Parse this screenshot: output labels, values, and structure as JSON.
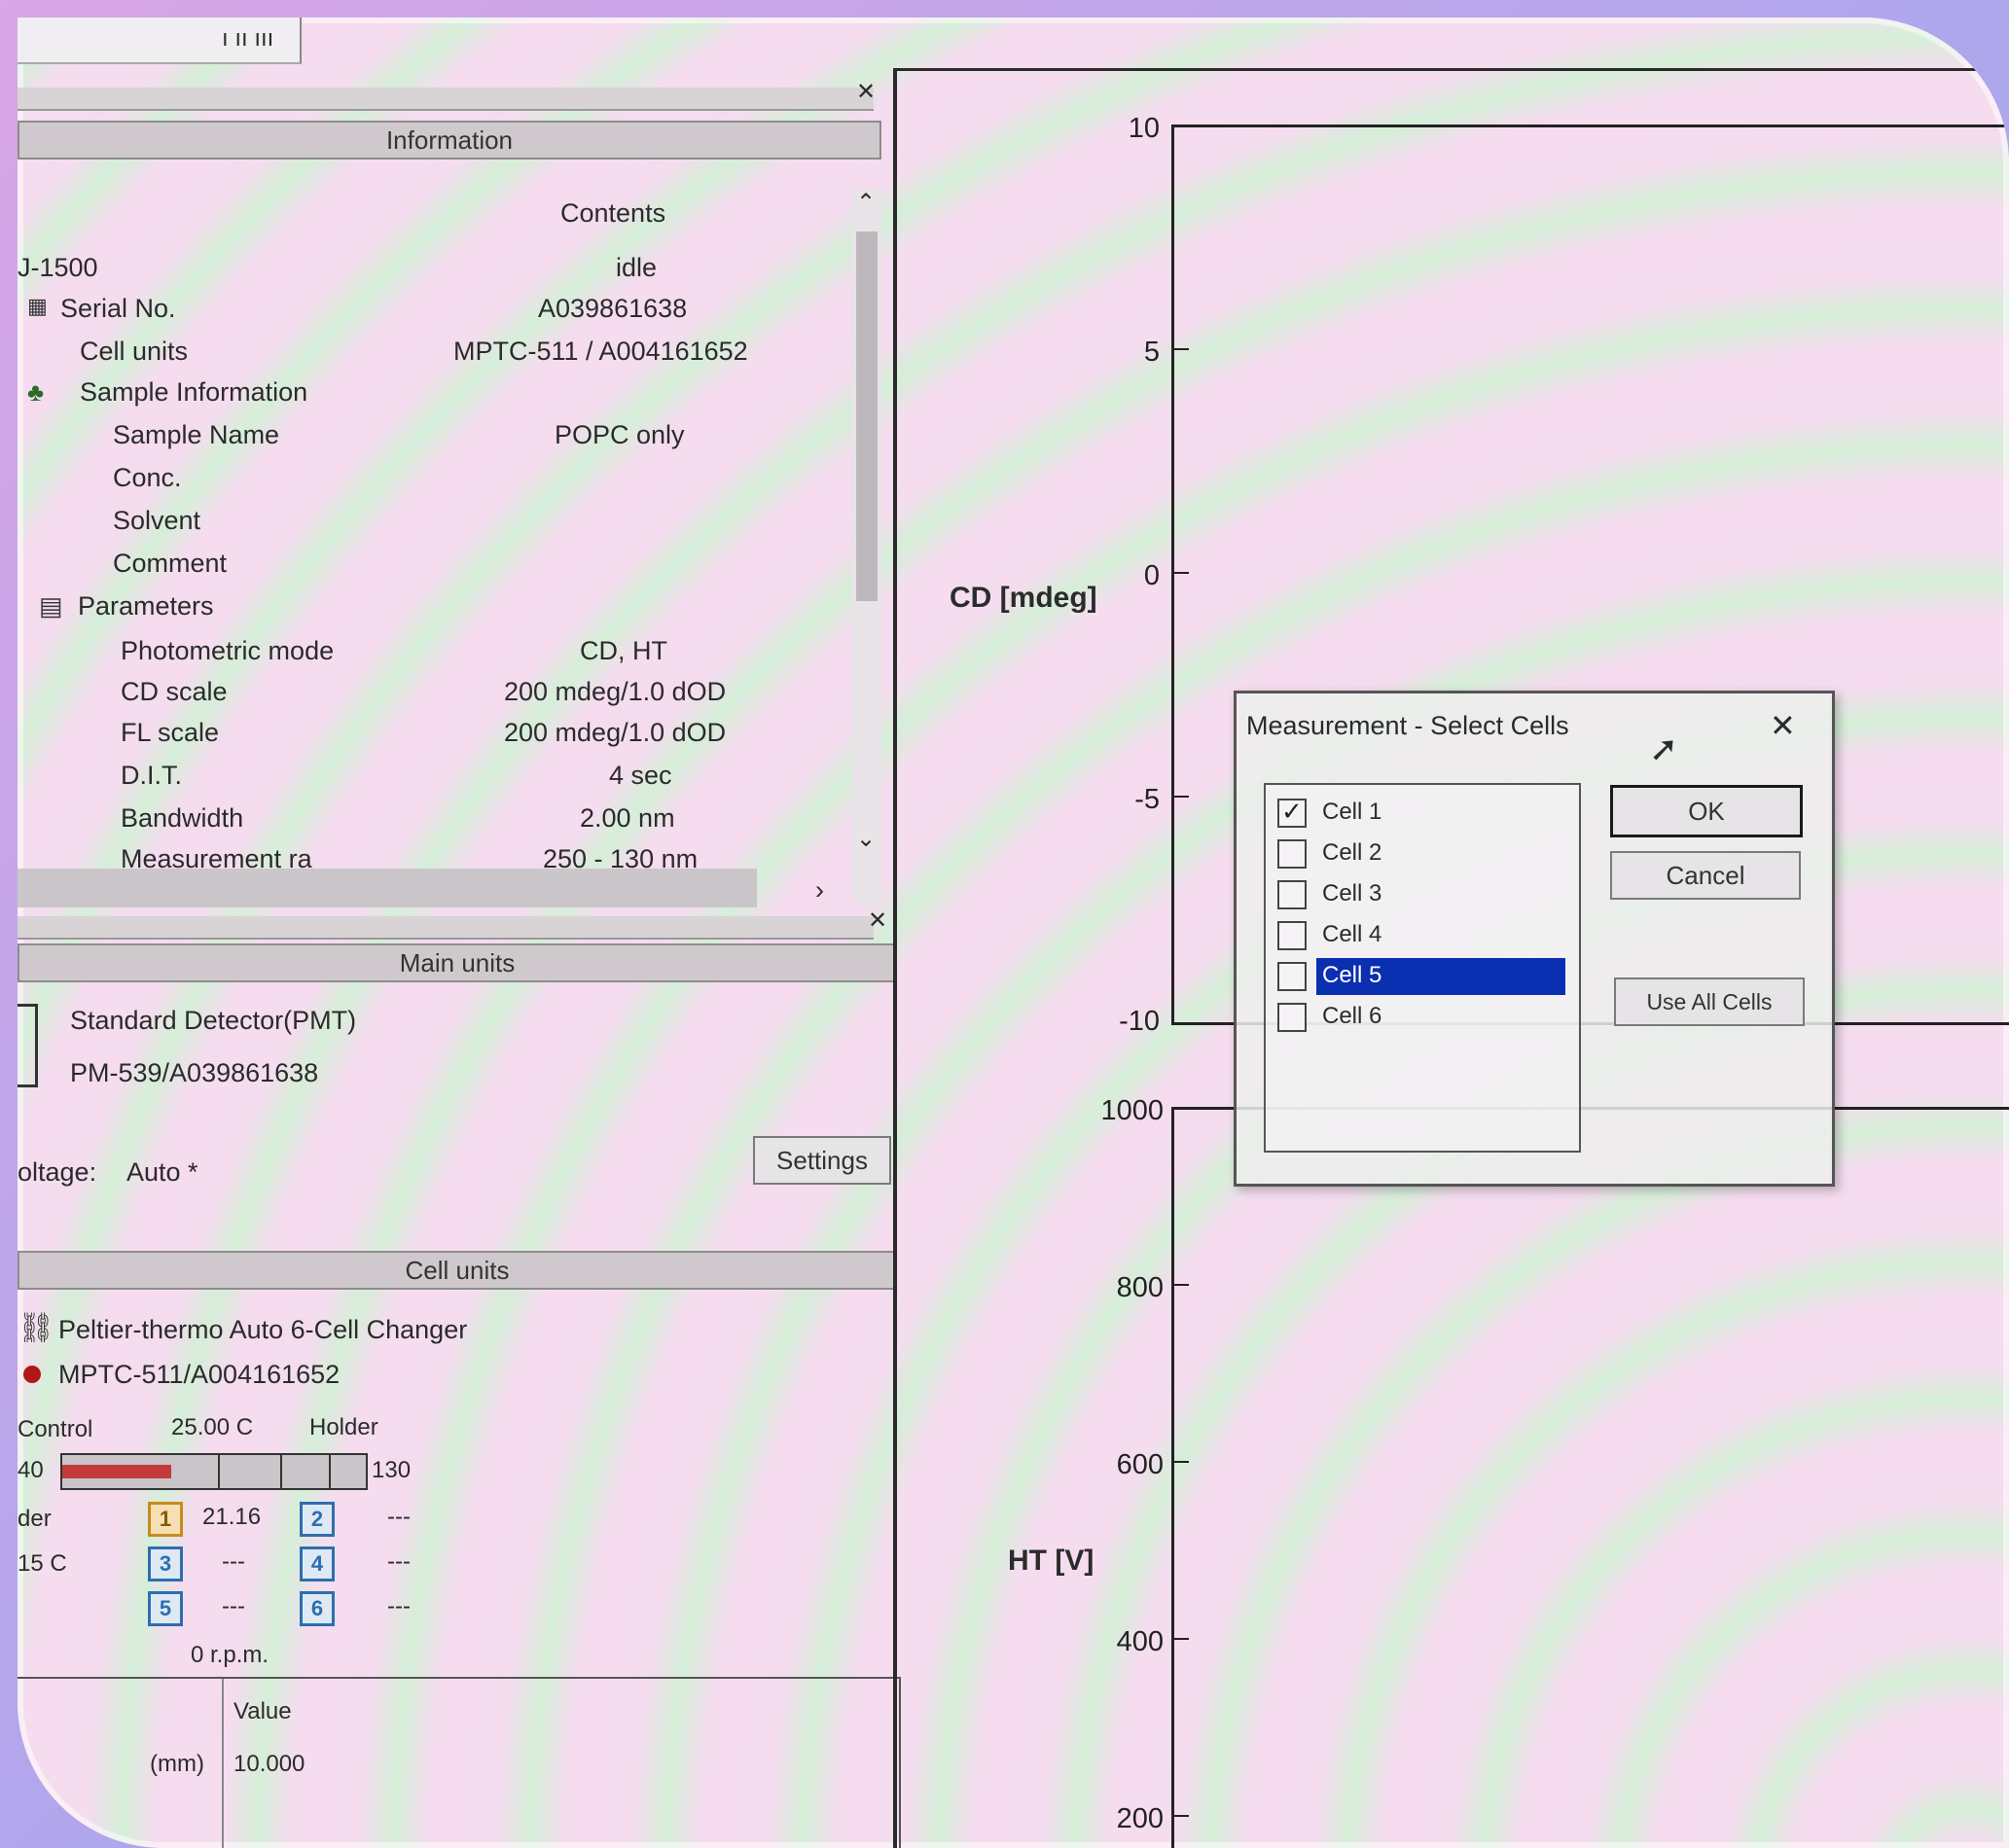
{
  "toolbar": {
    "fragment": "ı ıı ııı"
  },
  "info_panel": {
    "header": "Information",
    "column_header": "Contents",
    "rows": [
      {
        "label": "J-1500",
        "value": "idle"
      },
      {
        "label": "Serial No.",
        "value": "A039861638"
      },
      {
        "label": "Cell units",
        "value": "MPTC-511 / A004161652"
      },
      {
        "label": "Sample Information",
        "value": ""
      },
      {
        "label": "Sample Name",
        "value": "POPC only"
      },
      {
        "label": "Conc.",
        "value": ""
      },
      {
        "label": "Solvent",
        "value": ""
      },
      {
        "label": "Comment",
        "value": ""
      },
      {
        "label": "Parameters",
        "value": ""
      },
      {
        "label": "Photometric mode",
        "value": "CD, HT"
      },
      {
        "label": "CD scale",
        "value": "200 mdeg/1.0 dOD"
      },
      {
        "label": "FL scale",
        "value": "200 mdeg/1.0 dOD"
      },
      {
        "label": "D.I.T.",
        "value": "4 sec"
      },
      {
        "label": "Bandwidth",
        "value": "2.00 nm"
      },
      {
        "label": "Measurement ra",
        "value": "250 - 130 nm"
      }
    ]
  },
  "main_units": {
    "header": "Main units",
    "detector_name": "Standard Detector(PMT)",
    "detector_model": "PM-539/A039861638",
    "voltage_label": "oltage:",
    "voltage_value": "Auto *",
    "settings_label": "Settings"
  },
  "cell_units": {
    "header": "Cell units",
    "changer": "Peltier-thermo Auto 6-Cell Changer",
    "model": "MPTC-511/A004161652",
    "control_label": "Control",
    "control_temp": "25.00 C",
    "holder_label": "Holder",
    "scale_left": "40",
    "scale_right": "130",
    "der_label": "der",
    "temp_label": "15 C",
    "cells": [
      {
        "num": "1",
        "value": "21.16"
      },
      {
        "num": "2",
        "value": "---"
      },
      {
        "num": "3",
        "value": "---"
      },
      {
        "num": "4",
        "value": "---"
      },
      {
        "num": "5",
        "value": "---"
      },
      {
        "num": "6",
        "value": "---"
      }
    ],
    "rpm": "0 r.p.m."
  },
  "value_table": {
    "header": "Value",
    "row_label": "(mm)",
    "row_value": "10.000"
  },
  "chart_cd": {
    "ylabel": "CD [mdeg]",
    "ticks": [
      "10",
      "5",
      "0",
      "-5",
      "-10"
    ],
    "ylim": [
      -10,
      10
    ]
  },
  "chart_ht": {
    "ylabel": "HT [V]",
    "ticks": [
      "1000",
      "800",
      "600",
      "400",
      "200"
    ],
    "ylim": [
      200,
      1000
    ]
  },
  "dialog": {
    "title": "Measurement - Select Cells",
    "close": "✕",
    "cells": [
      {
        "label": "Cell 1",
        "checked": true,
        "selected": false
      },
      {
        "label": "Cell 2",
        "checked": false,
        "selected": false
      },
      {
        "label": "Cell 3",
        "checked": false,
        "selected": false
      },
      {
        "label": "Cell 4",
        "checked": false,
        "selected": false
      },
      {
        "label": "Cell 5",
        "checked": false,
        "selected": true
      },
      {
        "label": "Cell 6",
        "checked": false,
        "selected": false
      }
    ],
    "ok": "OK",
    "cancel": "Cancel",
    "use_all": "Use All Cells"
  }
}
